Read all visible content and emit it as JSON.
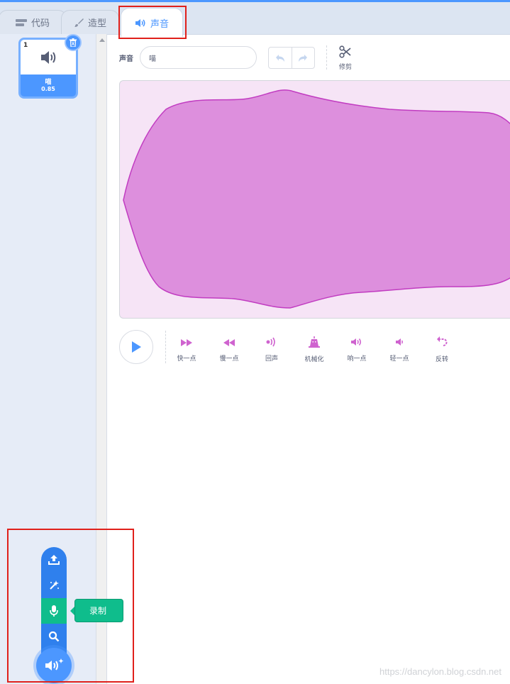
{
  "tabs": {
    "code": "代码",
    "costume": "造型",
    "sound": "声音"
  },
  "sound_list": [
    {
      "index": "1",
      "name": "喵",
      "duration": "0.85"
    }
  ],
  "editor": {
    "name_label": "声音",
    "name_value": "喵",
    "trim_label": "修剪"
  },
  "effects": [
    {
      "icon": "fast-forward-icon",
      "label": "快一点"
    },
    {
      "icon": "rewind-icon",
      "label": "慢一点"
    },
    {
      "icon": "echo-icon",
      "label": "回声"
    },
    {
      "icon": "robot-icon",
      "label": "机械化"
    },
    {
      "icon": "volume-up-icon",
      "label": "响一点"
    },
    {
      "icon": "volume-down-icon",
      "label": "轻一点"
    },
    {
      "icon": "reverse-icon",
      "label": "反转"
    }
  ],
  "add_menu": {
    "items": [
      "upload-icon",
      "surprise-icon",
      "microphone-icon",
      "search-icon"
    ],
    "tooltip": "录制"
  },
  "watermark": "https://dancylon.blog.csdn.net",
  "colors": {
    "accent": "#4c97ff",
    "waveform_fill": "#dd8fdd",
    "waveform_stroke": "#c13cc1",
    "effect_icon": "#cf63cf",
    "record_active": "#0fbd8c",
    "highlight_box": "#e0201b"
  }
}
